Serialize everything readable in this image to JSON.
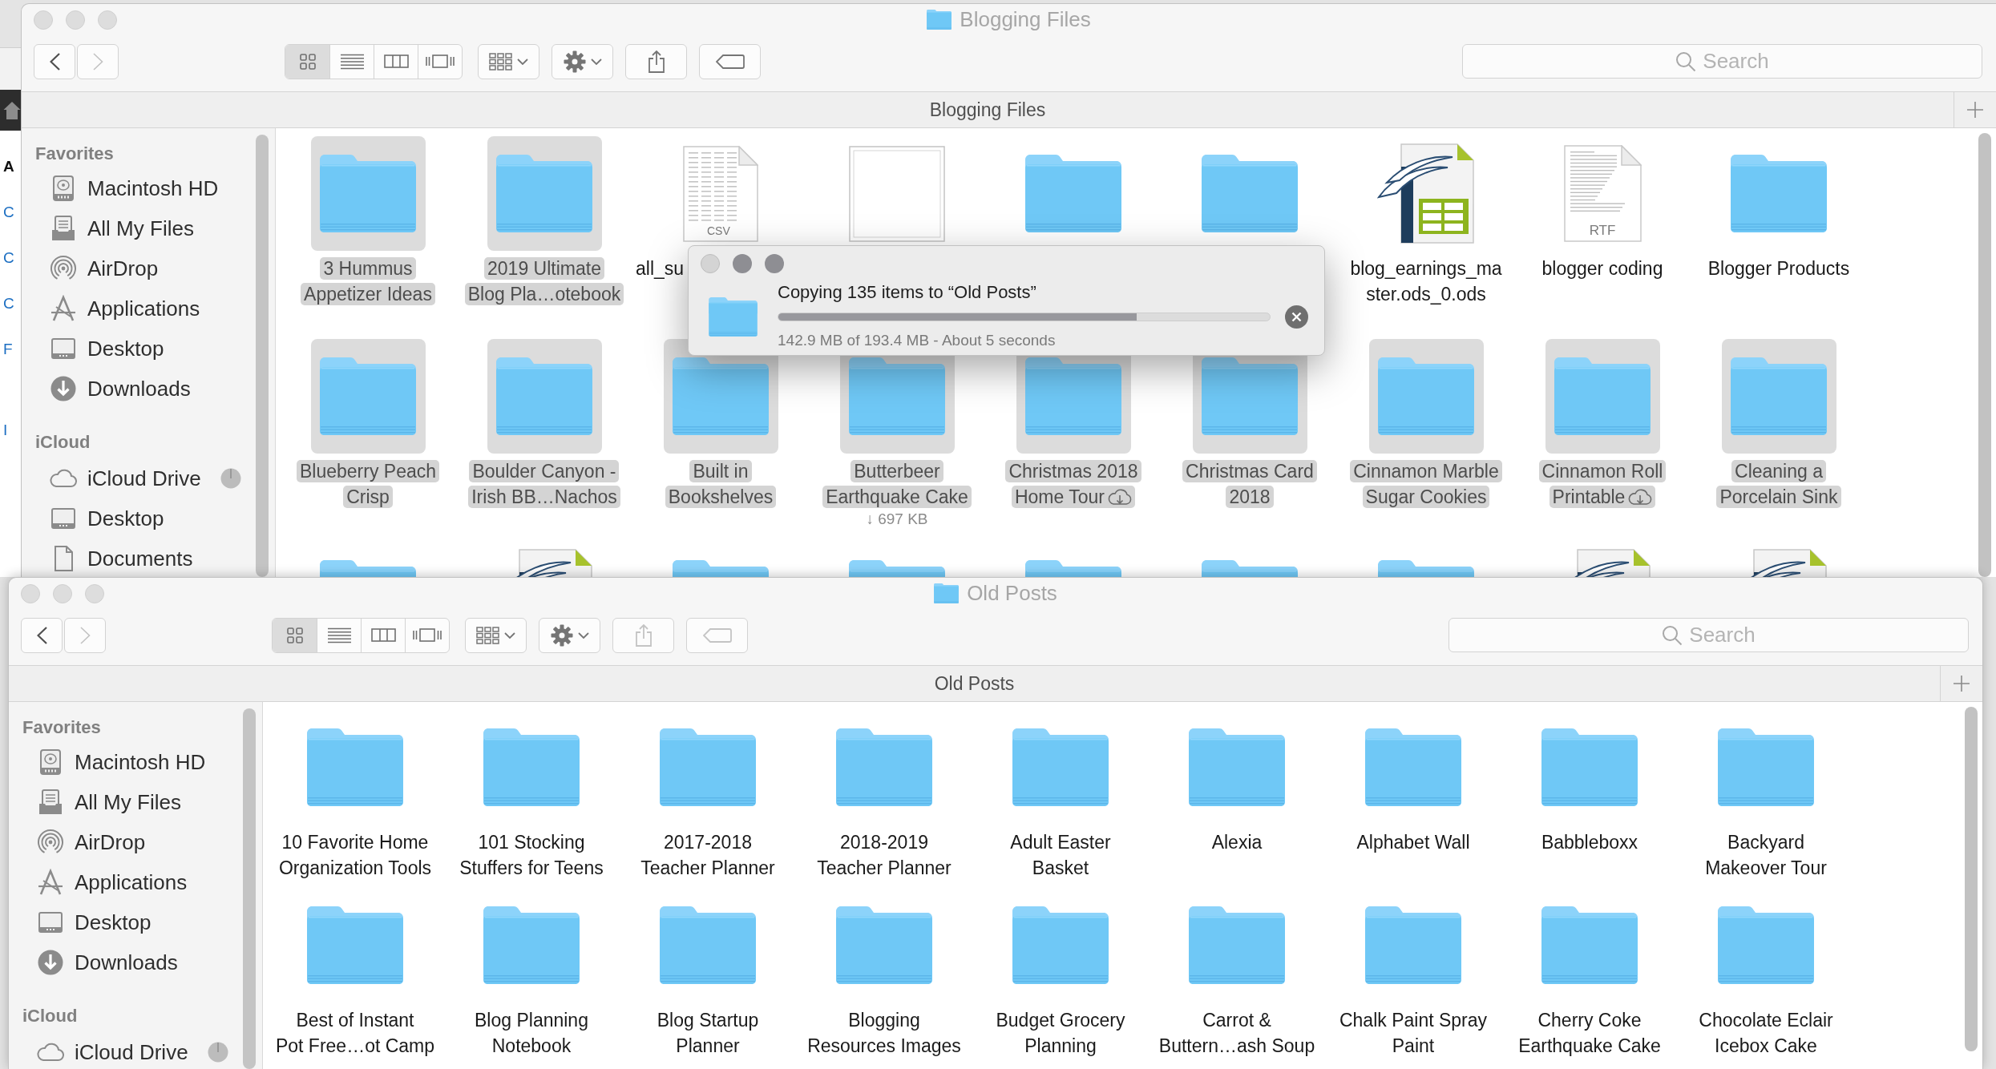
{
  "background_window": {
    "sections": [
      {
        "heading": "A",
        "links": [
          "C",
          "C",
          "C",
          "F"
        ]
      },
      {
        "links": [
          "I"
        ]
      }
    ]
  },
  "windows": [
    {
      "title": "Blogging Files",
      "active": false,
      "toolbar": {
        "navigation": [
          {
            "kind": "back",
            "disabled": false
          },
          {
            "kind": "forward",
            "disabled": true
          }
        ],
        "views": [
          {
            "kind": "icons",
            "selected": true
          },
          {
            "kind": "list",
            "selected": false
          },
          {
            "kind": "columns",
            "selected": false
          },
          {
            "kind": "cover-flow",
            "selected": false
          }
        ],
        "buttons": [
          {
            "kind": "arrange",
            "disabled": false
          },
          {
            "kind": "action",
            "disabled": false
          },
          {
            "kind": "share",
            "disabled": false
          },
          {
            "kind": "tags",
            "disabled": false
          }
        ],
        "search": {
          "placeholder": "Search"
        }
      },
      "tab_bar": {
        "title": "Blogging Files"
      },
      "sidebar": [
        {
          "title": "Favorites",
          "items": [
            {
              "kind": "hard-drive",
              "label": "Macintosh HD",
              "selected": false,
              "syncing": false
            },
            {
              "kind": "all-files",
              "label": "All My Files",
              "selected": false,
              "syncing": false
            },
            {
              "kind": "airdrop",
              "label": "AirDrop",
              "selected": false,
              "syncing": false
            },
            {
              "kind": "applications",
              "label": "Applications",
              "selected": false,
              "syncing": false
            },
            {
              "kind": "desktop",
              "label": "Desktop",
              "selected": false,
              "syncing": false
            },
            {
              "kind": "downloads",
              "label": "Downloads",
              "selected": false,
              "syncing": false
            }
          ]
        },
        {
          "title": "iCloud",
          "items": [
            {
              "kind": "icloud",
              "label": "iCloud Drive",
              "selected": false,
              "syncing": true
            },
            {
              "kind": "desktop",
              "label": "Desktop",
              "selected": false,
              "syncing": false
            },
            {
              "kind": "documents",
              "label": "Documents",
              "selected": false,
              "syncing": false
            }
          ]
        }
      ],
      "items": [
        {
          "kind": "folder",
          "name": "3 Hummus\nAppetizer Ideas",
          "selected": true,
          "cloud_download": false,
          "partly_covered": false
        },
        {
          "kind": "folder",
          "name": "2019 Ultimate\nBlog Pla…otebook",
          "selected": true,
          "cloud_download": false,
          "partly_covered": false
        },
        {
          "kind": "csv",
          "badge": "CSV",
          "name": "all_su",
          "selected": false,
          "cloud_download": false,
          "partly_covered": true
        },
        {
          "kind": "thumbnail",
          "selected": false
        },
        {
          "kind": "folder",
          "selected": false
        },
        {
          "kind": "folder",
          "selected": false
        },
        {
          "kind": "ods",
          "name": "blog_earnings_ma\nster.ods_0.ods",
          "selected": false,
          "cloud_download": false,
          "partly_covered": false
        },
        {
          "kind": "rtf",
          "badge": "RTF",
          "name": "blogger coding",
          "selected": false,
          "cloud_download": false,
          "partly_covered": false
        },
        {
          "kind": "folder",
          "name": "Blogger Products",
          "selected": false,
          "cloud_download": false,
          "partly_covered": false
        },
        {
          "kind": "folder",
          "name": "Blueberry Peach\nCrisp",
          "selected": true,
          "cloud_download": false,
          "partly_covered": false
        },
        {
          "kind": "folder",
          "name": "Boulder Canyon -\nIrish BB…Nachos",
          "selected": true,
          "cloud_download": false,
          "partly_covered": false
        },
        {
          "kind": "folder",
          "name": "Built in\nBookshelves",
          "selected": true,
          "cloud_download": false,
          "partly_covered": false
        },
        {
          "kind": "folder",
          "name": "Butterbeer\nEarthquake Cake",
          "info": "↓ 697 KB",
          "selected": true,
          "cloud_download": false,
          "partly_covered": false
        },
        {
          "kind": "folder",
          "name": "Christmas 2018\nHome Tour",
          "selected": true,
          "cloud_download": true,
          "partly_covered": false
        },
        {
          "kind": "folder",
          "name": "Christmas Card\n2018",
          "selected": true,
          "cloud_download": false,
          "partly_covered": false
        },
        {
          "kind": "folder",
          "name": "Cinnamon Marble\nSugar Cookies",
          "selected": true,
          "cloud_download": false,
          "partly_covered": false
        },
        {
          "kind": "folder",
          "name": "Cinnamon Roll\nPrintable",
          "selected": true,
          "cloud_download": true,
          "partly_covered": false
        },
        {
          "kind": "folder",
          "name": "Cleaning a\nPorcelain Sink",
          "selected": true,
          "cloud_download": false,
          "partly_covered": false
        }
      ],
      "partly_visible_row": [
        {
          "kind": "folder",
          "selected": false
        },
        {
          "kind": "ods",
          "selected": false
        },
        {
          "kind": "folder",
          "selected": false
        },
        {
          "kind": "folder",
          "selected": false
        },
        {
          "kind": "folder",
          "selected": false
        },
        {
          "kind": "folder",
          "selected": false
        },
        {
          "kind": "folder",
          "selected": false
        },
        {
          "kind": "ods",
          "selected": false
        },
        {
          "kind": "ods",
          "selected": false
        }
      ]
    },
    {
      "title": "Old Posts",
      "active": false,
      "toolbar": {
        "navigation": [
          {
            "kind": "back",
            "disabled": false
          },
          {
            "kind": "forward",
            "disabled": true
          }
        ],
        "views": [
          {
            "kind": "icons",
            "selected": true
          },
          {
            "kind": "list",
            "selected": false
          },
          {
            "kind": "columns",
            "selected": false
          },
          {
            "kind": "cover-flow",
            "selected": false
          }
        ],
        "buttons": [
          {
            "kind": "arrange",
            "disabled": false
          },
          {
            "kind": "action",
            "disabled": false
          },
          {
            "kind": "share",
            "disabled": true
          },
          {
            "kind": "tags",
            "disabled": true
          }
        ],
        "search": {
          "placeholder": "Search"
        }
      },
      "tab_bar": {
        "title": "Old Posts"
      },
      "sidebar": [
        {
          "title": "Favorites",
          "items": [
            {
              "kind": "hard-drive",
              "label": "Macintosh HD",
              "selected": false,
              "syncing": false
            },
            {
              "kind": "all-files",
              "label": "All My Files",
              "selected": false,
              "syncing": false
            },
            {
              "kind": "airdrop",
              "label": "AirDrop",
              "selected": false,
              "syncing": false
            },
            {
              "kind": "applications",
              "label": "Applications",
              "selected": false,
              "syncing": false
            },
            {
              "kind": "desktop",
              "label": "Desktop",
              "selected": false,
              "syncing": false
            },
            {
              "kind": "downloads",
              "label": "Downloads",
              "selected": false,
              "syncing": false
            }
          ]
        },
        {
          "title": "iCloud",
          "items": [
            {
              "kind": "icloud",
              "label": "iCloud Drive",
              "selected": false,
              "syncing": true
            }
          ]
        }
      ],
      "items": [
        {
          "kind": "folder",
          "name": "10 Favorite Home\nOrganization Tools",
          "selected": false
        },
        {
          "kind": "folder",
          "name": "101 Stocking\nStuffers for Teens",
          "selected": false
        },
        {
          "kind": "folder",
          "name": "2017-2018\nTeacher Planner",
          "selected": false
        },
        {
          "kind": "folder",
          "name": "2018-2019\nTeacher Planner",
          "selected": false
        },
        {
          "kind": "folder",
          "name": "Adult Easter\nBasket",
          "selected": false
        },
        {
          "kind": "folder",
          "name": "Alexia",
          "selected": false
        },
        {
          "kind": "folder",
          "name": "Alphabet Wall",
          "selected": false
        },
        {
          "kind": "folder",
          "name": "Babbleboxx",
          "selected": false
        },
        {
          "kind": "folder",
          "name": "Backyard\nMakeover Tour",
          "selected": false
        },
        {
          "kind": "folder",
          "name": "Best of Instant\nPot Free…ot Camp",
          "selected": false
        },
        {
          "kind": "folder",
          "name": "Blog Planning\nNotebook",
          "selected": false
        },
        {
          "kind": "folder",
          "name": "Blog Startup\nPlanner",
          "selected": false
        },
        {
          "kind": "folder",
          "name": "Blogging\nResources Images",
          "selected": false
        },
        {
          "kind": "folder",
          "name": "Budget Grocery\nPlanning",
          "selected": false
        },
        {
          "kind": "folder",
          "name": "Carrot &\nButtern…ash Soup",
          "selected": false
        },
        {
          "kind": "folder",
          "name": "Chalk Paint Spray\nPaint",
          "selected": false
        },
        {
          "kind": "folder",
          "name": "Cherry Coke\nEarthquake Cake",
          "selected": false
        },
        {
          "kind": "folder",
          "name": "Chocolate Eclair\nIcebox Cake",
          "selected": false
        }
      ]
    }
  ],
  "copy_dialog": {
    "window_buttons": [
      {
        "disabled": true
      },
      {
        "disabled": false
      },
      {
        "disabled": false
      }
    ],
    "title": "Copying 135 items to “Old Posts”",
    "progress": {
      "level": 0.73
    },
    "status": "142.9 MB of 193.4 MB - About 5 seconds"
  }
}
